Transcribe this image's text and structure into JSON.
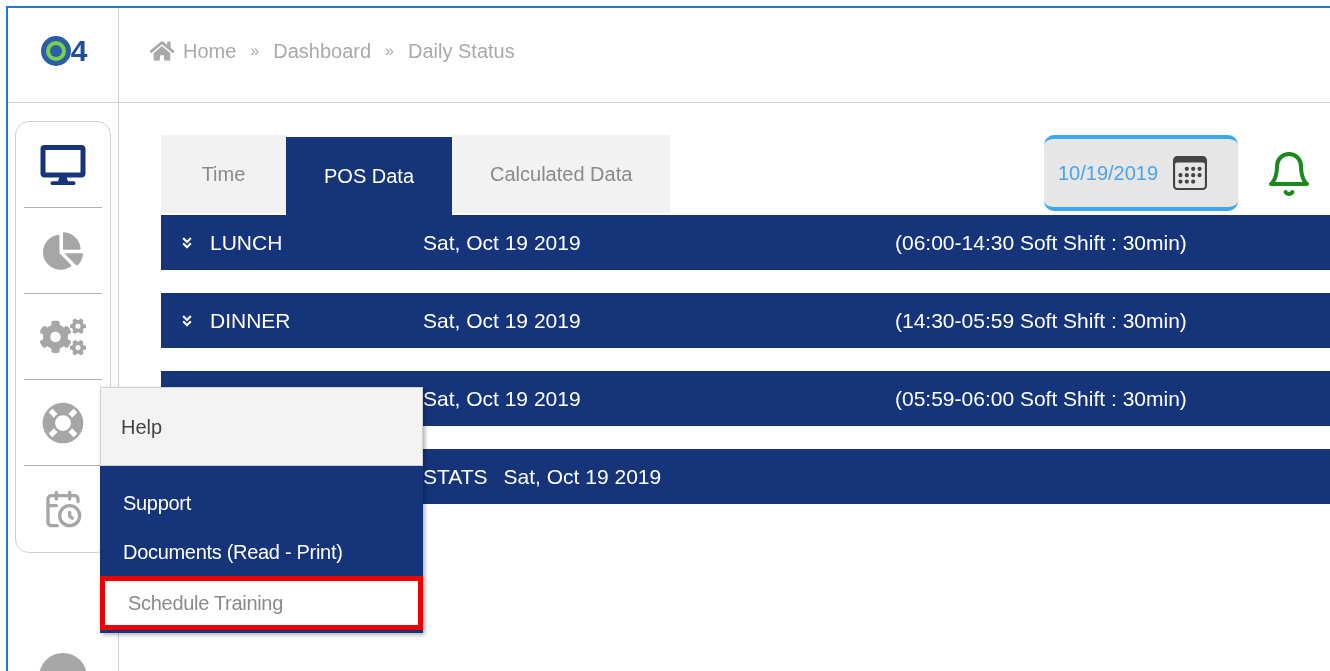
{
  "logo": {
    "text": "4"
  },
  "breadcrumb": [
    "Home",
    "Dashboard",
    "Daily Status"
  ],
  "breadcrumb_separator": "»",
  "sidebar": {
    "items": [
      {
        "kind": "monitor",
        "selected": true
      },
      {
        "kind": "pie",
        "selected": false
      },
      {
        "kind": "gears",
        "selected": false
      },
      {
        "kind": "lifebuoy",
        "selected": false
      },
      {
        "kind": "calendar",
        "selected": false
      }
    ]
  },
  "tabs": [
    {
      "label": "Time",
      "selected": false
    },
    {
      "label": "POS Data",
      "selected": true
    },
    {
      "label": "Calculated Data",
      "selected": false
    }
  ],
  "date_field": {
    "value": "10/19/2019"
  },
  "shifts": [
    {
      "kind": "full",
      "label": "LUNCH",
      "date": "Sat, Oct 19 2019",
      "hours": "(06:00-14:30  Soft Shift : 30min)"
    },
    {
      "kind": "full",
      "label": "DINNER",
      "date": "Sat, Oct 19 2019",
      "hours": "(14:30-05:59  Soft Shift : 30min)"
    },
    {
      "kind": "covered",
      "date": "Sat, Oct 19 2019",
      "hours": "(05:59-06:00  Soft Shift : 30min)"
    },
    {
      "kind": "inline",
      "label": "STATS",
      "date": "Sat, Oct 19 2019"
    }
  ],
  "help_menu": {
    "title": "Help",
    "items": [
      {
        "label": "Support",
        "selected": false
      },
      {
        "label": "Documents (Read - Print)",
        "selected": false
      },
      {
        "label": "Schedule Training",
        "selected": true
      }
    ]
  }
}
